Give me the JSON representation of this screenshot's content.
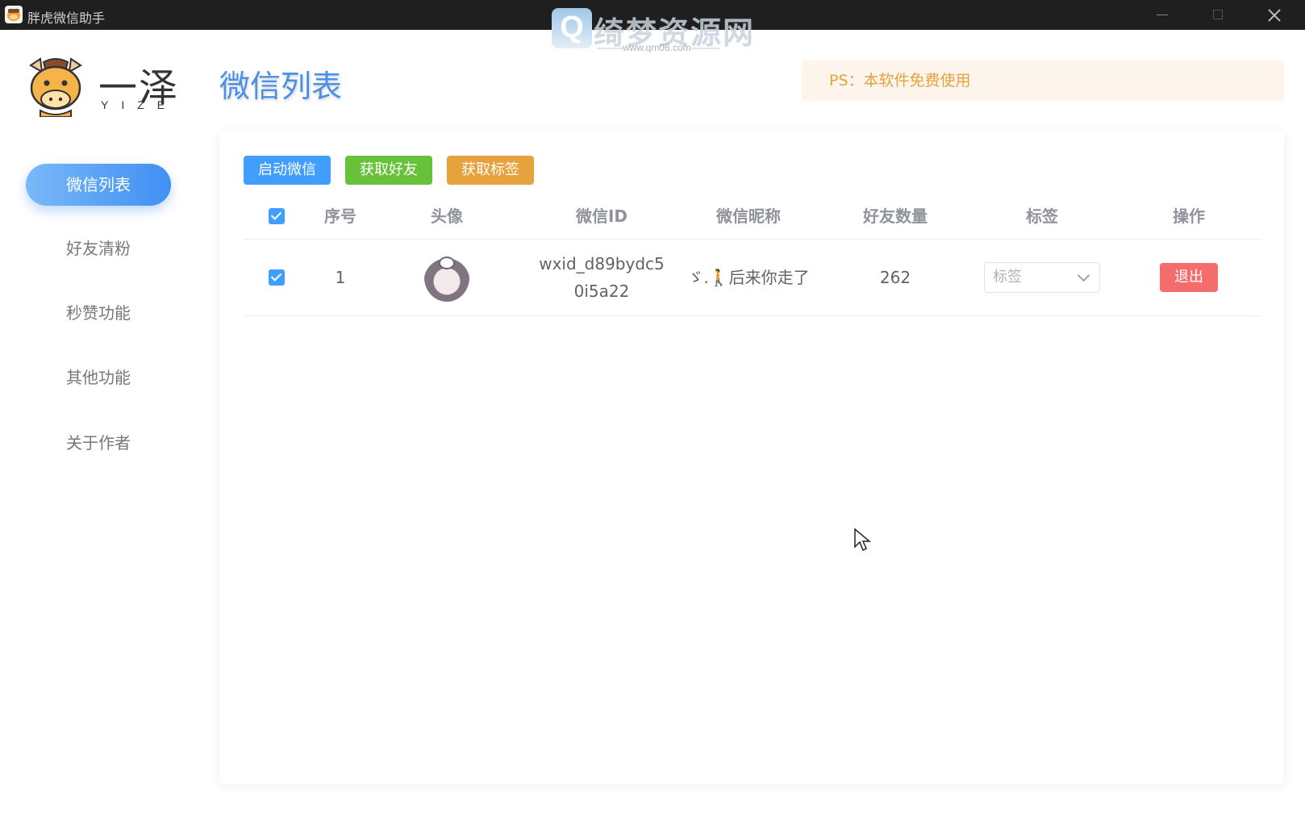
{
  "window": {
    "title": "胖虎微信助手"
  },
  "watermark": {
    "letter": "Q",
    "title": "绮梦资源网",
    "subtitle": "--------www.qm06.com---------"
  },
  "brand": {
    "name": "一泽",
    "latin": "YIZE"
  },
  "sidebar": {
    "items": [
      {
        "label": "微信列表",
        "active": true
      },
      {
        "label": "好友清粉",
        "active": false
      },
      {
        "label": "秒赞功能",
        "active": false
      },
      {
        "label": "其他功能",
        "active": false
      },
      {
        "label": "关于作者",
        "active": false
      }
    ]
  },
  "page": {
    "title": "微信列表"
  },
  "notice": {
    "text": "PS：本软件免费使用"
  },
  "toolbar": {
    "start_label": "启动微信",
    "friends_label": "获取好友",
    "tags_label": "获取标签"
  },
  "table": {
    "columns": [
      "序号",
      "头像",
      "微信ID",
      "微信昵称",
      "好友数量",
      "标签",
      "操作"
    ],
    "rows": [
      {
        "checked": true,
        "index": "1",
        "wxid": "wxid_d89bydc5 0i5a22",
        "nickname": "ゞ.🚶后来你走了",
        "friend_count": "262",
        "tag_placeholder": "标签",
        "action_label": "退出"
      }
    ]
  },
  "colors": {
    "primary": "#409eff",
    "success": "#67c23a",
    "warning": "#e6a23c",
    "danger": "#f56c6c"
  }
}
